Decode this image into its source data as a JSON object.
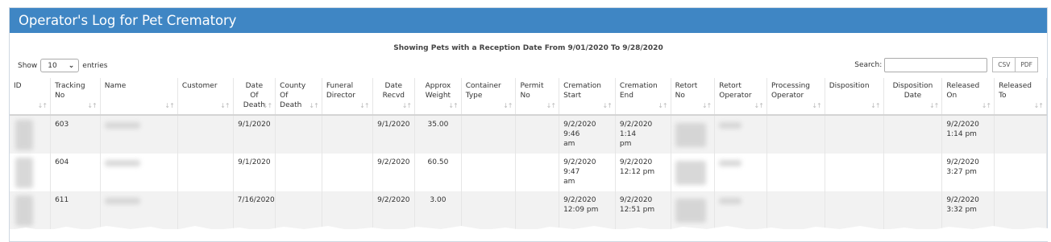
{
  "header": {
    "title": "Operator's Log for Pet Crematory"
  },
  "subtitle": "Showing Pets with a Reception Date From 9/01/2020 To 9/28/2020",
  "length_control": {
    "show_label": "Show",
    "value": "10",
    "entries_label": "entries"
  },
  "search": {
    "label": "Search:",
    "value": ""
  },
  "export_buttons": {
    "csv": "CSV",
    "pdf": "PDF"
  },
  "table": {
    "columns": [
      {
        "key": "id",
        "label": "ID"
      },
      {
        "key": "tracking",
        "label": "Tracking No"
      },
      {
        "key": "name",
        "label": "Name"
      },
      {
        "key": "customer",
        "label": "Customer"
      },
      {
        "key": "date_of_death",
        "label": "Date Of Death"
      },
      {
        "key": "county",
        "label": "County Of Death"
      },
      {
        "key": "funeral",
        "label": "Funeral Director"
      },
      {
        "key": "date_recvd",
        "label": "Date Recvd"
      },
      {
        "key": "weight",
        "label": "Approx Weight"
      },
      {
        "key": "container",
        "label": "Container Type"
      },
      {
        "key": "permit",
        "label": "Permit No"
      },
      {
        "key": "cremation_start",
        "label": "Cremation Start"
      },
      {
        "key": "cremation_end",
        "label": "Cremation End"
      },
      {
        "key": "retort_no",
        "label": "Retort No"
      },
      {
        "key": "retort_operator",
        "label": "Retort Operator"
      },
      {
        "key": "processing_operator",
        "label": "Processing Operator"
      },
      {
        "key": "disposition",
        "label": "Disposition"
      },
      {
        "key": "disposition_date",
        "label": "Disposition Date"
      },
      {
        "key": "released_on",
        "label": "Released On"
      },
      {
        "key": "released_to",
        "label": "Released To"
      }
    ],
    "header_lines": {
      "id": [
        "ID"
      ],
      "tracking": [
        "Tracking",
        "No"
      ],
      "name": [
        "Name"
      ],
      "customer": [
        "Customer"
      ],
      "date_of_death": [
        "Date",
        "Of",
        "Death"
      ],
      "county": [
        "County",
        "Of",
        "Death"
      ],
      "funeral": [
        "Funeral",
        "Director"
      ],
      "date_recvd": [
        "Date",
        "Recvd"
      ],
      "weight": [
        "Approx",
        "Weight"
      ],
      "container": [
        "Container",
        "Type"
      ],
      "permit": [
        "Permit",
        "No"
      ],
      "cremation_start": [
        "Cremation",
        "Start"
      ],
      "cremation_end": [
        "Cremation",
        "End"
      ],
      "retort_no": [
        "Retort",
        "No"
      ],
      "retort_operator": [
        "Retort",
        "Operator"
      ],
      "processing_operator": [
        "Processing",
        "Operator"
      ],
      "disposition": [
        "Disposition"
      ],
      "disposition_date": [
        "Disposition",
        "Date"
      ],
      "released_on": [
        "Released",
        "On"
      ],
      "released_to": [
        "Released",
        "To"
      ]
    },
    "rows": [
      {
        "tracking": "603",
        "date_of_death": "9/1/2020",
        "date_recvd": "9/1/2020",
        "weight": "35.00",
        "cremation_start": [
          "9/2/2020 9:46",
          "am"
        ],
        "cremation_end": [
          "9/2/2020 1:14",
          "pm"
        ],
        "released_on": [
          "9/2/2020",
          "1:14 pm"
        ]
      },
      {
        "tracking": "604",
        "date_of_death": "9/1/2020",
        "date_recvd": "9/2/2020",
        "weight": "60.50",
        "cremation_start": [
          "9/2/2020 9:47",
          "am"
        ],
        "cremation_end": [
          "9/2/2020",
          "12:12 pm"
        ],
        "released_on": [
          "9/2/2020",
          "3:27 pm"
        ]
      },
      {
        "tracking": "611",
        "date_of_death": "7/16/2020",
        "date_recvd": "9/2/2020",
        "weight": "3.00",
        "cremation_start": [
          "9/2/2020",
          "12:09 pm"
        ],
        "cremation_end": [
          "9/2/2020",
          "12:51 pm"
        ],
        "released_on": [
          "9/2/2020",
          "3:32 pm"
        ]
      }
    ]
  }
}
